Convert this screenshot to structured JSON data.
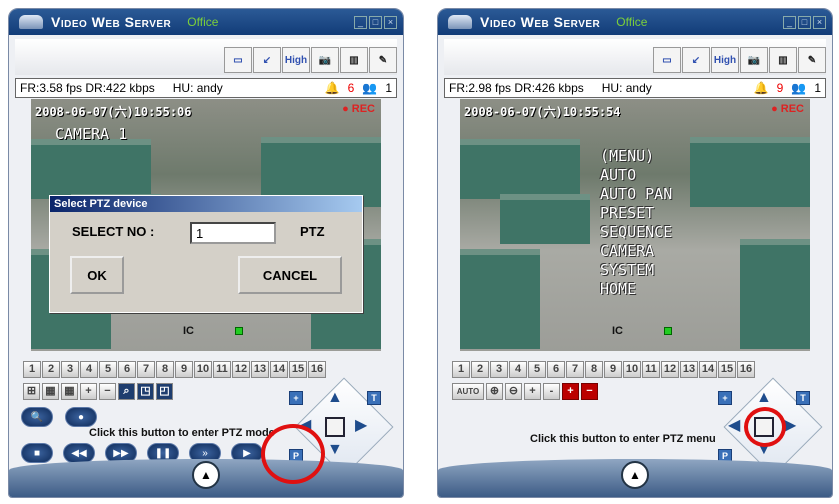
{
  "windows": [
    {
      "title": "Video Web Server",
      "location": "Office",
      "toolbar": {
        "quality_label": "High"
      },
      "status": {
        "frame_rate": "FR:3.58 fps",
        "data_rate": "DR:422 kbps",
        "user": "HU: andy",
        "alarm_count": "6",
        "user_count": "1"
      },
      "video": {
        "timestamp": "2008-06-07(六)10:55:06",
        "camera_label": "CAMERA 1",
        "rec_label": "",
        "ic_label": "IC"
      },
      "dialog": {
        "title": "Select PTZ device",
        "select_label": "SELECT NO :",
        "value": "1",
        "unit": "PTZ",
        "ok": "OK",
        "cancel": "CANCEL"
      },
      "channels": [
        "1",
        "2",
        "3",
        "4",
        "5",
        "6",
        "7",
        "8",
        "9",
        "10",
        "11",
        "12",
        "13",
        "14",
        "15",
        "16"
      ],
      "tools": [
        "⊞",
        "▦",
        "▦",
        "+",
        "−",
        "⌕",
        "◳",
        "◰"
      ],
      "hint": "Click this button to enter PTZ mode"
    },
    {
      "title": "Video Web Server",
      "location": "Office",
      "toolbar": {
        "quality_label": "High"
      },
      "status": {
        "frame_rate": "FR:2.98 fps",
        "data_rate": "DR:426 kbps",
        "user": "HU: andy",
        "alarm_count": "9",
        "user_count": "1"
      },
      "video": {
        "timestamp": "2008-06-07(六)10:55:54",
        "ic_label": "IC",
        "osd_menu": [
          "(MENU)",
          "AUTO",
          "AUTO PAN",
          "PRESET",
          "SEQUENCE",
          "CAMERA",
          "SYSTEM",
          "HOME"
        ]
      },
      "channels": [
        "1",
        "2",
        "3",
        "4",
        "5",
        "6",
        "7",
        "8",
        "9",
        "10",
        "11",
        "12",
        "13",
        "14",
        "15",
        "16"
      ],
      "tools": [
        "AUTO",
        "⊕",
        "⊖",
        "+",
        "-",
        "+",
        "−"
      ],
      "hint": "Click this button to enter PTZ menu"
    }
  ],
  "colors": {
    "titlebar": "#1a4680",
    "location": "#7ccf3a",
    "highlight_circle": "#e01010",
    "alarm": "#e00000"
  }
}
